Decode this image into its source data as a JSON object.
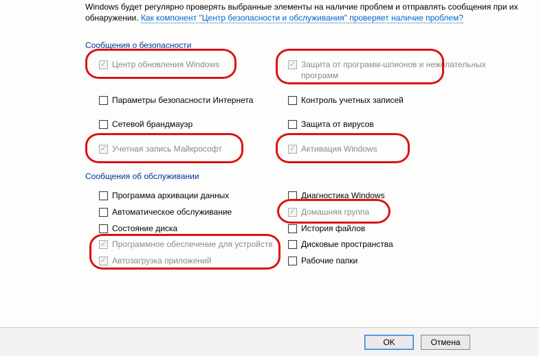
{
  "intro": {
    "text_before": "Windows будет регулярно проверять выбранные элементы на наличие проблем и отправлять сообщения при их обнаружении. ",
    "link_text": "Как компонент \"Центр безопасности и обслуживания\" проверяет наличие проблем?"
  },
  "sections": {
    "security": {
      "title": "Сообщения о безопасности",
      "items": {
        "windows_update": {
          "label": "Центр обновления Windows",
          "checked": true,
          "disabled": true,
          "highlighted": true
        },
        "spyware": {
          "label": "Защита от программ-шпионов и нежелательных программ",
          "checked": true,
          "disabled": true,
          "highlighted": true
        },
        "inet_security": {
          "label": "Параметры безопасности Интернета",
          "checked": false,
          "disabled": false,
          "highlighted": false
        },
        "uac": {
          "label": "Контроль учетных записей",
          "checked": false,
          "disabled": false,
          "highlighted": false
        },
        "firewall": {
          "label": "Сетевой брандмауэр",
          "checked": false,
          "disabled": false,
          "highlighted": false
        },
        "virus": {
          "label": "Защита от вирусов",
          "checked": false,
          "disabled": false,
          "highlighted": false
        },
        "ms_account": {
          "label": "Учетная запись Майкрософт",
          "checked": true,
          "disabled": true,
          "highlighted": true
        },
        "activation": {
          "label": "Активация Windows",
          "checked": true,
          "disabled": true,
          "highlighted": true
        }
      }
    },
    "maintenance": {
      "title": "Сообщения об обслуживании",
      "items": {
        "backup": {
          "label": "Программа архивации данных",
          "checked": false,
          "disabled": false,
          "highlighted": false
        },
        "win_diag": {
          "label": "Диагностика Windows",
          "checked": false,
          "disabled": false,
          "highlighted": false
        },
        "auto_maint": {
          "label": "Автоматическое обслуживание",
          "checked": false,
          "disabled": false,
          "highlighted": false
        },
        "homegroup": {
          "label": "Домашняя группа",
          "checked": true,
          "disabled": true,
          "highlighted": true
        },
        "disk_state": {
          "label": "Состояние диска",
          "checked": false,
          "disabled": false,
          "highlighted": false
        },
        "file_history": {
          "label": "История файлов",
          "checked": false,
          "disabled": false,
          "highlighted": false
        },
        "device_software": {
          "label": "Программное обеспечение для устройств",
          "checked": true,
          "disabled": true,
          "highlighted": true
        },
        "storage_spaces": {
          "label": "Дисковые пространства",
          "checked": false,
          "disabled": false,
          "highlighted": false
        },
        "app_startup": {
          "label": "Автозагрузка приложений",
          "checked": true,
          "disabled": true,
          "highlighted": true
        },
        "work_folders": {
          "label": "Рабочие папки",
          "checked": false,
          "disabled": false,
          "highlighted": false
        }
      }
    }
  },
  "buttons": {
    "ok": "OK",
    "cancel": "Отмена"
  }
}
